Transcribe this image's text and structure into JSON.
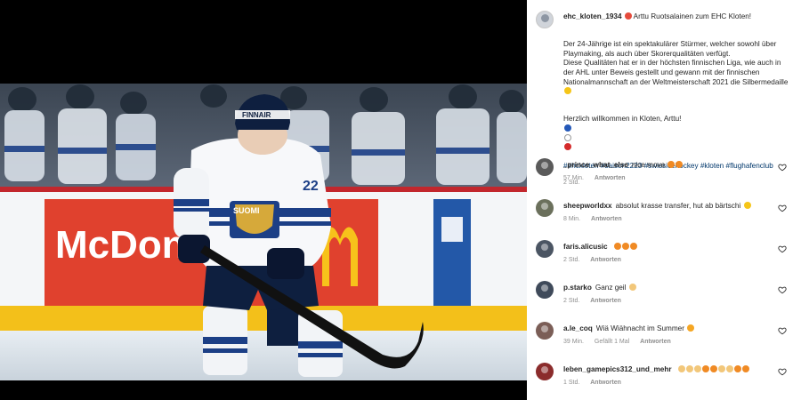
{
  "post": {
    "username": "ehc_kloten_1934",
    "caption_headline": "Arttu Ruotsalainen zum EHC Kloten!",
    "caption_body": "Der 24-Jährige ist ein spektakulärer Stürmer, welcher sowohl über Playmaking, als auch über Skorerqualitäten verfügt.\nDiese Qualitäten hat er in der höchsten finnischen Liga, wie auch in der AHL unter Beweis gestellt und gewann mit der finnischen Nationalmannschaft an der Weltmeisterschaft 2021 die Silbermedaille",
    "welcome": "Herzlich willkommen in Kloten, Arttu!",
    "hashtags": "#ehckloten #saison2223 #swissicehockey #kloten #flughafenclub",
    "time": "2 Std."
  },
  "photo": {
    "ad_text": "McDon",
    "jersey_word": "SUOMI",
    "jersey_number": "22",
    "helmet_text": "FINNAIR"
  },
  "comments": [
    {
      "user": "_prince_what_else",
      "text": "nice move",
      "emoji": [
        "fire-emoji",
        "fire-emoji"
      ],
      "time": "57 Min.",
      "likes": "",
      "reply": "Antworten",
      "avatar_color": "#5a5a5a"
    },
    {
      "user": "sheepworldxx",
      "text": "absolut krasse transfer, hut ab bärtschi",
      "emoji": [
        "star-eyes-emoji"
      ],
      "time": "8 Min.",
      "likes": "",
      "reply": "Antworten",
      "avatar_color": "#6b705c"
    },
    {
      "user": "faris.alicusic",
      "text": "",
      "emoji": [
        "fire-emoji",
        "fire-emoji",
        "fire-emoji"
      ],
      "time": "2 Std.",
      "likes": "",
      "reply": "Antworten",
      "avatar_color": "#4b5563"
    },
    {
      "user": "p.starko",
      "text": "Ganz geil",
      "emoji": [
        "raising-hands-emoji"
      ],
      "time": "2 Std.",
      "likes": "",
      "reply": "Antworten",
      "avatar_color": "#3f4a5a"
    },
    {
      "user": "a.le_coq",
      "text": "Wiä Wiähnacht im Summer",
      "emoji": [
        "heart-eyes-emoji"
      ],
      "time": "39 Min.",
      "likes": "Gefällt 1 Mal",
      "reply": "Antworten",
      "avatar_color": "#7b5e57"
    },
    {
      "user": "leben_gamepics312_und_mehr",
      "text": "",
      "emoji": [
        "clap-emoji",
        "clap-emoji",
        "clap-emoji",
        "fire-emoji",
        "fire-emoji",
        "clap-emoji",
        "clap-emoji",
        "fire-emoji",
        "fire-emoji"
      ],
      "time": "1 Std.",
      "likes": "",
      "reply": "Antworten",
      "avatar_color": "#8b2c2c"
    }
  ],
  "colors": {
    "link": "#00376b",
    "muted": "#8e8e8e",
    "fire": "#f08a24",
    "star": "#f5c518",
    "ad_red": "#e0412e",
    "jersey_blue": "#1c3f86"
  }
}
